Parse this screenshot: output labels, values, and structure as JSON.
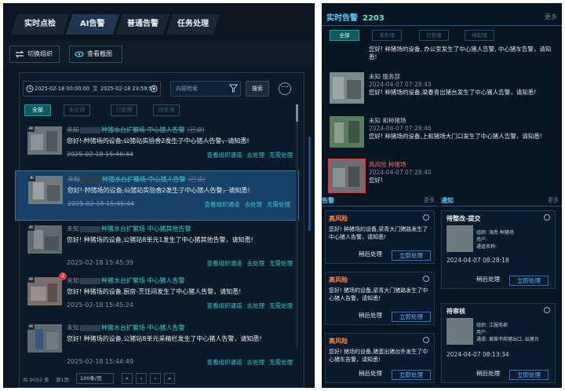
{
  "left": {
    "tabs": [
      {
        "label": "实时点检"
      },
      {
        "label": "AI告警"
      },
      {
        "label": "普通告警"
      },
      {
        "label": "任务处理"
      }
    ],
    "toolbar": {
      "switch_org": "切换组织",
      "view_screenshot": "查看截图"
    },
    "filters": {
      "date_start": "2025-02-18 00:00:00",
      "date_sep": "至",
      "date_end": "2025-02-18 23:59:59",
      "keyword_placeholder": "内容检索",
      "search_label": "搜索",
      "more_label": "···"
    },
    "status_chips": [
      "全部",
      "未处理",
      "已处理",
      "待处理"
    ],
    "alerts": [
      {
        "unknown": "未知",
        "location": "种猪水台扩繁场 中心猪人告警",
        "status": "(已读)",
        "desc": "您好! 种猪场的设备,公猪站实验舍2发生了中心猪人告警，请知悉!",
        "time": "2025-02-18 15:46:44",
        "actions": [
          "查看组织通道",
          "去处理",
          "无需处理"
        ]
      },
      {
        "unknown": "未知",
        "location": "种猪水台扩繁场 中心猪人告警",
        "status": "(已读)",
        "desc": "您好! 种猪场的设备,公猪站实验舍2发生了中心猪人告警，请知悉!",
        "time": "2025-02-18 15:46:44",
        "actions": [
          "查看组织通道",
          "去处理",
          "无需处理"
        ]
      },
      {
        "unknown": "未知",
        "location": "种猪水台扩繁场 中心猪其他告警",
        "status": "",
        "desc": "您好! 种猪场的设备,公猪站8单元1发生了中心猪其他告警，请知悉!",
        "time": "2025-02-18 15:45:39",
        "actions": [
          "查看组织通道",
          "去处理",
          "无需处理"
        ]
      },
      {
        "unknown": "未知",
        "location": "种猪水台扩繁场 中心猪人告警",
        "status": "",
        "desc": "您好! 种猪场的设备,厨房-烹饪间发生了中心猪人告警，请知悉!",
        "time": "2025-02-18 15:45:24",
        "actions": [
          "查看组织通道",
          "去处理",
          "无需处理"
        ]
      },
      {
        "unknown": "未知",
        "location": "种猪水台扩繁场 中心猪人告警",
        "status": "",
        "desc": "您好! 种猪场的设备,公猪站8单元采精栏发生了中心猪人告警，请知悉!",
        "time": "2025-02-18 15:44:49",
        "actions": [
          "查看组织通道",
          "去处理",
          "无需处理"
        ]
      }
    ],
    "pager": {
      "total": "共 9052 条",
      "page": "第1页",
      "page_size": "100条/页",
      "first": "«",
      "prev": "‹",
      "next": "›",
      "last": "»"
    }
  },
  "right": {
    "title": "实时告警",
    "count": "2203",
    "more": "更多",
    "chips": [
      "全部",
      "未处理",
      "已处理",
      "待处理"
    ],
    "items": [
      {
        "line1": "",
        "line2": "",
        "line3": "您好! 种猪场的设备, 办公室发生了中心猪人告警, 中心猪车告警，请知悉!"
      },
      {
        "line1": "未知 服务部",
        "line2": "2024-04-07 07:28:43",
        "line3": "您好! 种猪场的设备,梁春青出猪台发生了中心猪人告警，请知悉!"
      },
      {
        "line1": "未知 和种猪场",
        "line2": "2024-04-07 07:28:46",
        "line3": "您好! 种猪场的设备,上和猪场大门口发生了中心猪人告警，请知悉!"
      },
      {
        "line1": "高风险 种猪场",
        "line2": "2024-04-07 07:28:40",
        "line3": "您好!"
      }
    ],
    "alarm_section": {
      "title": "告警",
      "more": "更多",
      "cards": [
        {
          "title": "高风险",
          "text": "您好! 种猪场的设备,梁青大门猪路发生了中心猪人告警，请知悉!",
          "later": "稍后处理",
          "now": "立即处理"
        },
        {
          "title": "高风险",
          "text": "您好! 猪场的设备,梁青大门猪路发生了中心猪人告警，请知悉!",
          "later": "稍后处理",
          "now": "立即处理"
        },
        {
          "title": "高风险",
          "text": "您好! 猪场的设备,猪蛋出猪台外发生了中心猪车告警，请知悉!",
          "later": "稍后处理",
          "now": "立即处理"
        }
      ]
    },
    "notice_section": {
      "title": "通知",
      "more": "更多",
      "cards": [
        {
          "title": "待整改-提交",
          "f1": "组织: 海南 种猪场",
          "f2": "用户:",
          "f3": "通道名称:",
          "time": "2024-04-07 08:28:18",
          "later": "稍后处理",
          "now": "立即处理"
        },
        {
          "title": "待审核",
          "f1": "组织: 江服务部",
          "f2": "用户:",
          "f3": "通道: 黄陂书苑猪出口, 出猪台",
          "time": "2024-04-07 08:13:34",
          "later": "稍后处理",
          "now": "立即处理"
        }
      ]
    }
  }
}
